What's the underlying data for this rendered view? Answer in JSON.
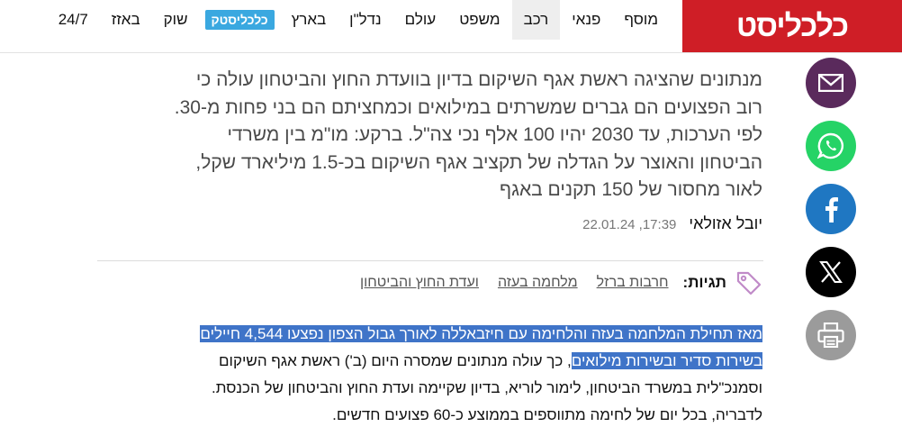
{
  "header": {
    "logo": "כלכליסט",
    "nav": [
      {
        "label": "24/7"
      },
      {
        "label": "באזז"
      },
      {
        "label": "שוק"
      },
      {
        "label": "כלכליסטק",
        "badge": true
      },
      {
        "label": "בארץ"
      },
      {
        "label": "נדל\"ן"
      },
      {
        "label": "עולם"
      },
      {
        "label": "משפט"
      },
      {
        "label": "רכב",
        "active": true
      },
      {
        "label": "פנאי"
      },
      {
        "label": "מוסף"
      }
    ]
  },
  "social": [
    {
      "icon": "mail-icon",
      "color": "#5a2a5c"
    },
    {
      "icon": "whatsapp-icon",
      "color": "#25d366"
    },
    {
      "icon": "facebook-icon",
      "color": "#1f77c2"
    },
    {
      "icon": "x-icon",
      "color": "#000000"
    },
    {
      "icon": "print-icon",
      "color": "#9b9b9b"
    }
  ],
  "article": {
    "subtitle_lines": [
      "מנתונים שהציגה ראשת אגף השיקום בדיון בוועדת החוץ והביטחון עולה כי",
      "רוב הפצועים הם גברים שמשרתים במילואים וכמחציתם הם בני פחות מ-30.",
      "לפי הערכות, עד 2030 יהיו 100 אלף נכי צה\"ל. ברקע: מו\"מ בין משרדי",
      "הביטחון והאוצר על הגדלה של תקציב אגף השיקום בכ-1.5 מיליארד שקל,",
      "לאור מחסור של 150 תקנים באגף"
    ],
    "author": "יובל אזולאי",
    "date": "17:39, 22.01.24",
    "tags_label": "תגיות:",
    "tags": [
      "חרבות ברזל",
      "מלחמה בעזה",
      "ועדת החוץ והביטחון"
    ],
    "body": {
      "line1_highlight": "מאז תחילת המלחמה בעזה והלחימה עם חיזבאללה לאורך גבול הצפון נפצעו 4,544 חיילים",
      "line2_highlight": "בשירות סדיר ובשירות מילואים",
      "line2_rest": ", כך עולה מנתונים שמסרה היום (ב') ראשת אגף השיקום",
      "line3": "וסמנכ\"לית במשרד הביטחון, לימור לוריא, בדיון שקיימה ועדת החוץ והביטחון של הכנסת.",
      "line4": "לדבריה, בכל יום של לחימה מתווספים בממוצע כ-60 פצועים חדשים."
    }
  },
  "colors": {
    "brand_red": "#cf1e26",
    "highlight": "#3f74c8",
    "tech_badge": "#3aa8e0"
  }
}
